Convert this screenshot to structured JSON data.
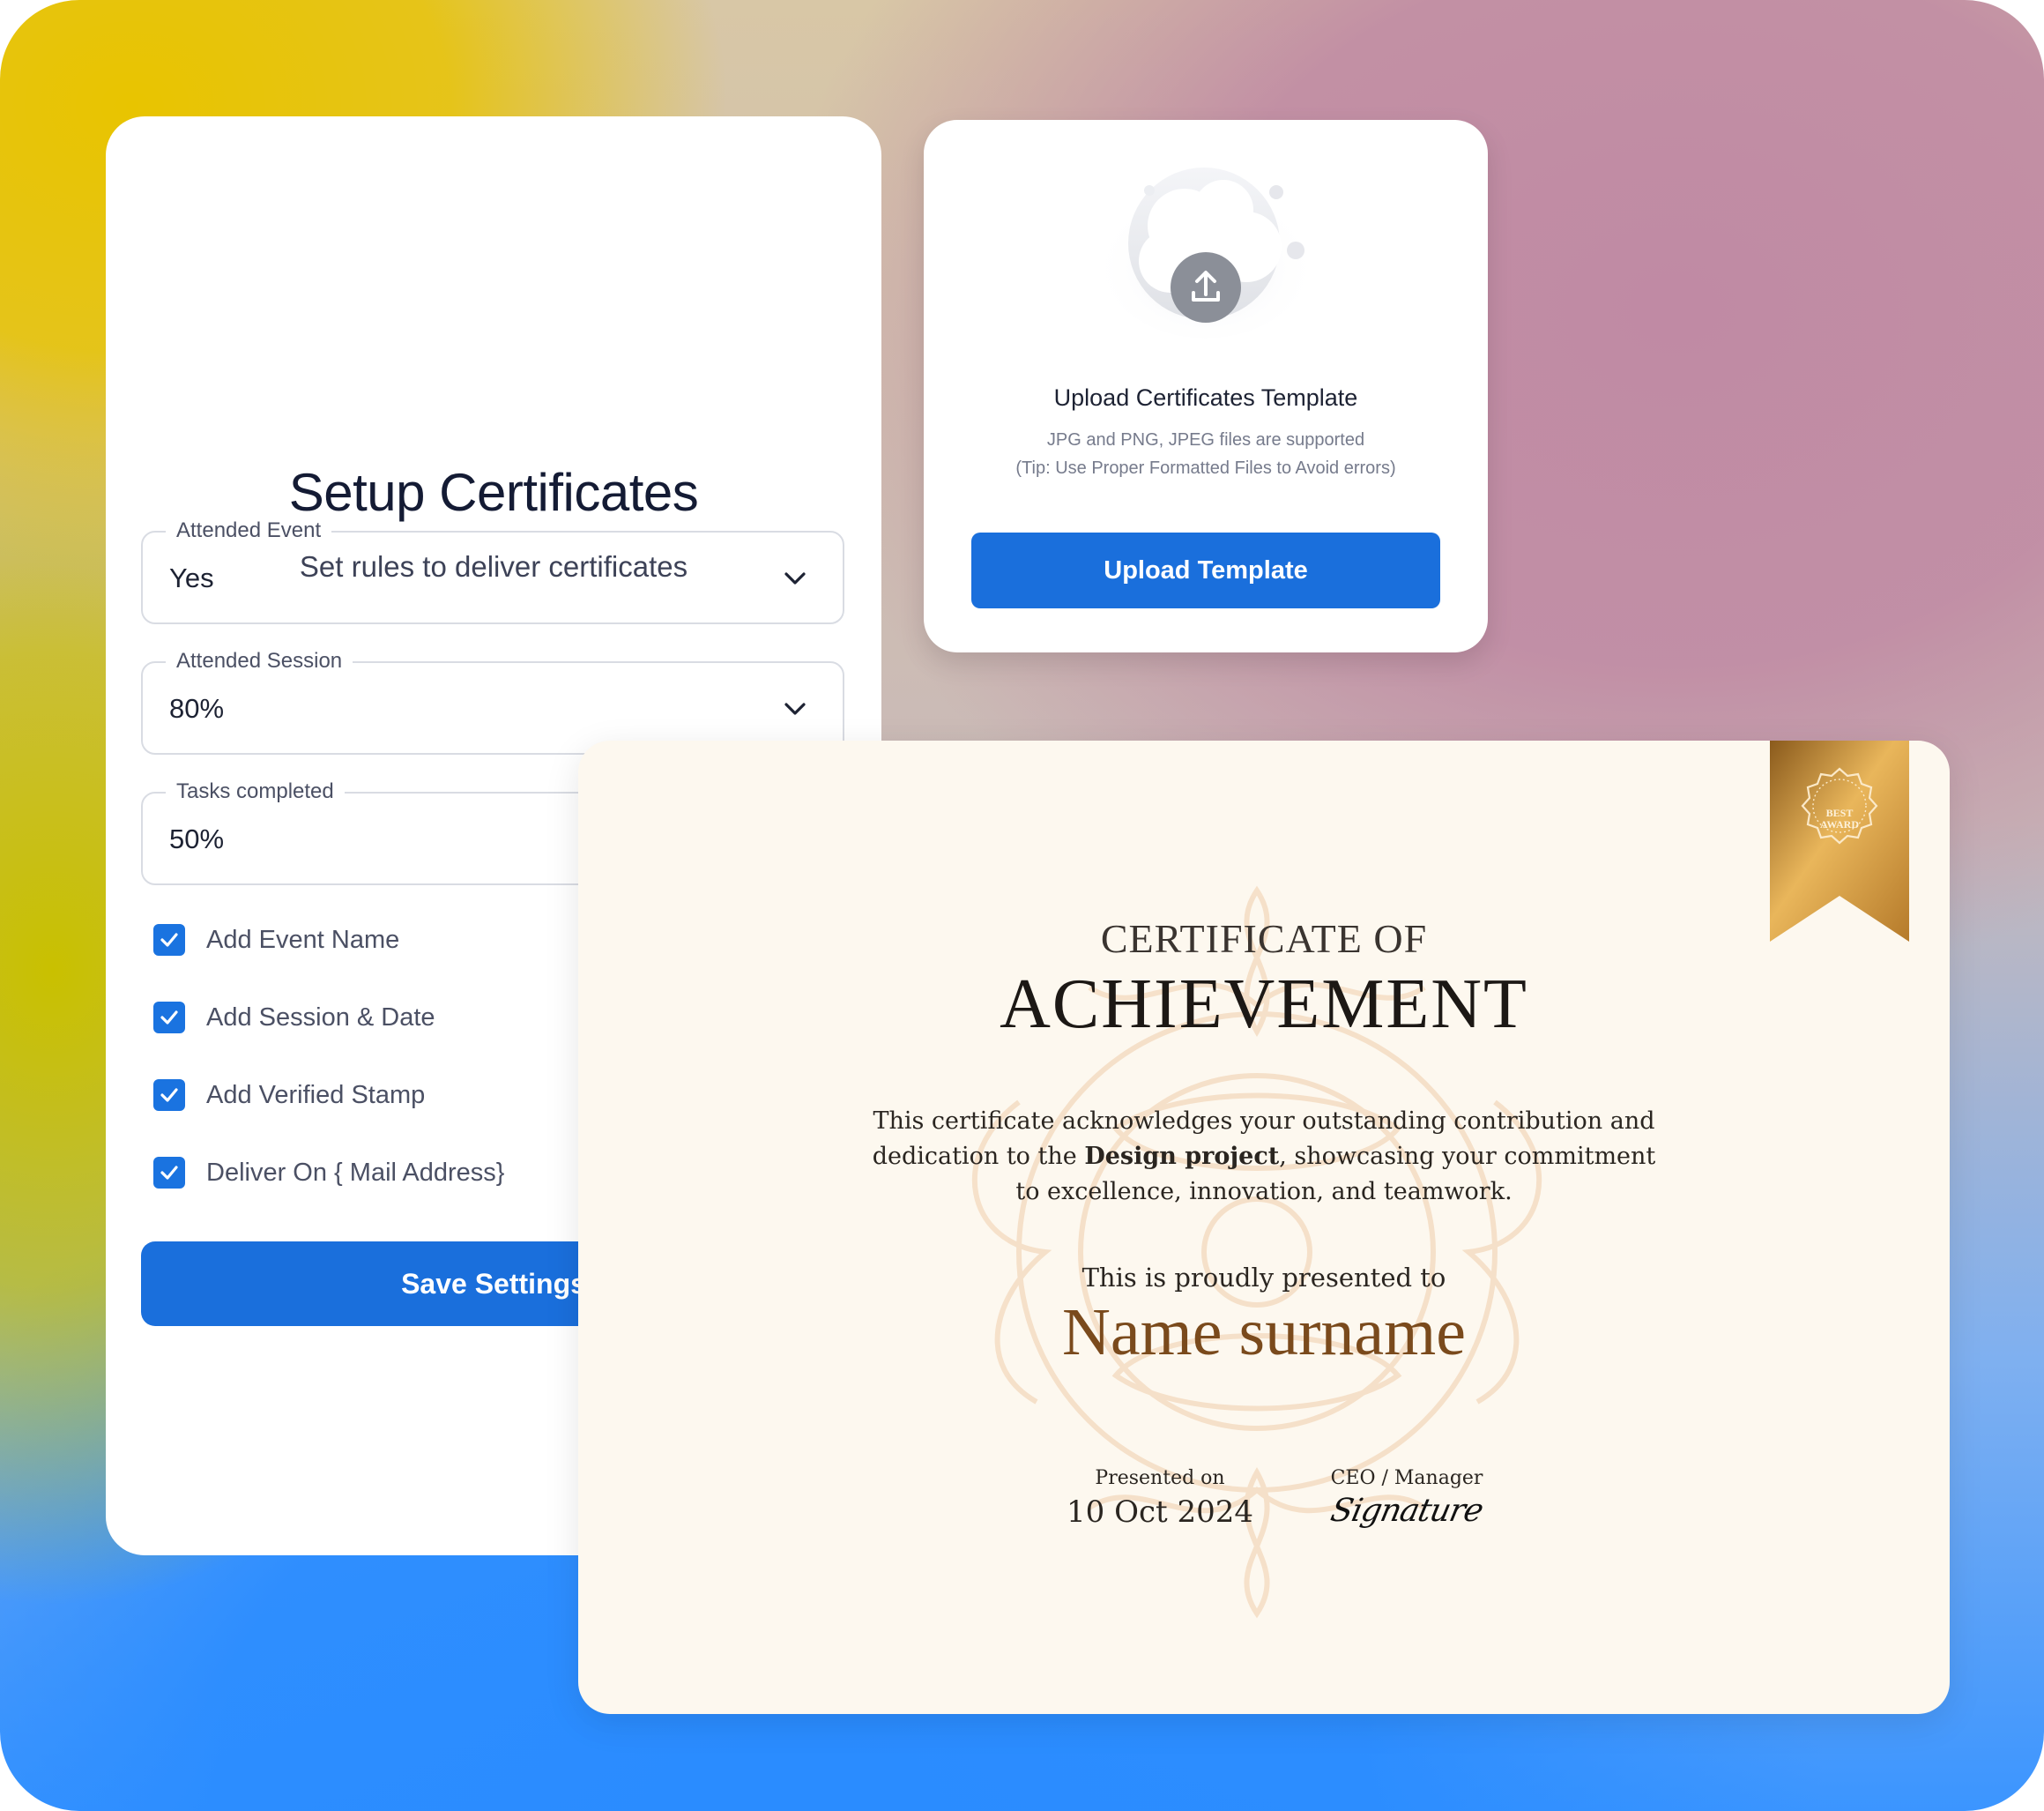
{
  "setup": {
    "title": "Setup Certificates",
    "subtitle": "Set rules to deliver certificates",
    "fields": [
      {
        "label": "Attended Event",
        "value": "Yes"
      },
      {
        "label": "Attended Session",
        "value": "80%"
      },
      {
        "label": "Tasks completed",
        "value": "50%"
      }
    ],
    "checkboxes": [
      {
        "label": "Add Event Name",
        "checked": true
      },
      {
        "label": "Add Session & Date",
        "checked": true
      },
      {
        "label": "Add Verified Stamp",
        "checked": true
      },
      {
        "label": "Deliver On { Mail Address}",
        "checked": true
      }
    ],
    "save_label": "Save Settings"
  },
  "upload": {
    "title": "Upload Certificates Template",
    "hint_formats": "JPG and PNG, JPEG files are supported",
    "hint_tip": "(Tip: Use Proper Formatted Files to Avoid errors)",
    "button_label": "Upload Template",
    "icon": "cloud-upload-icon"
  },
  "certificate": {
    "title_line1": "CERTIFICATE OF",
    "title_line2": "ACHIEVEMENT",
    "body_before": "This certificate acknowledges your outstanding contribution and dedication to the ",
    "body_bold": "Design project",
    "body_after": ", showcasing your commitment to excellence, innovation, and teamwork.",
    "presented_to": "This is proudly presented to",
    "recipient": "Name surname",
    "presented_on_label": "Presented on",
    "presented_on_date": "10 Oct 2024",
    "signer_label": "CEO / Manager",
    "signature": "Signature",
    "badge_line1": "BEST",
    "badge_line2": "AWARD"
  },
  "colors": {
    "primary": "#1a6fdc",
    "checkbox": "#1a73e0",
    "gold": "#c98a2a",
    "recipient": "#7a4a1c"
  }
}
